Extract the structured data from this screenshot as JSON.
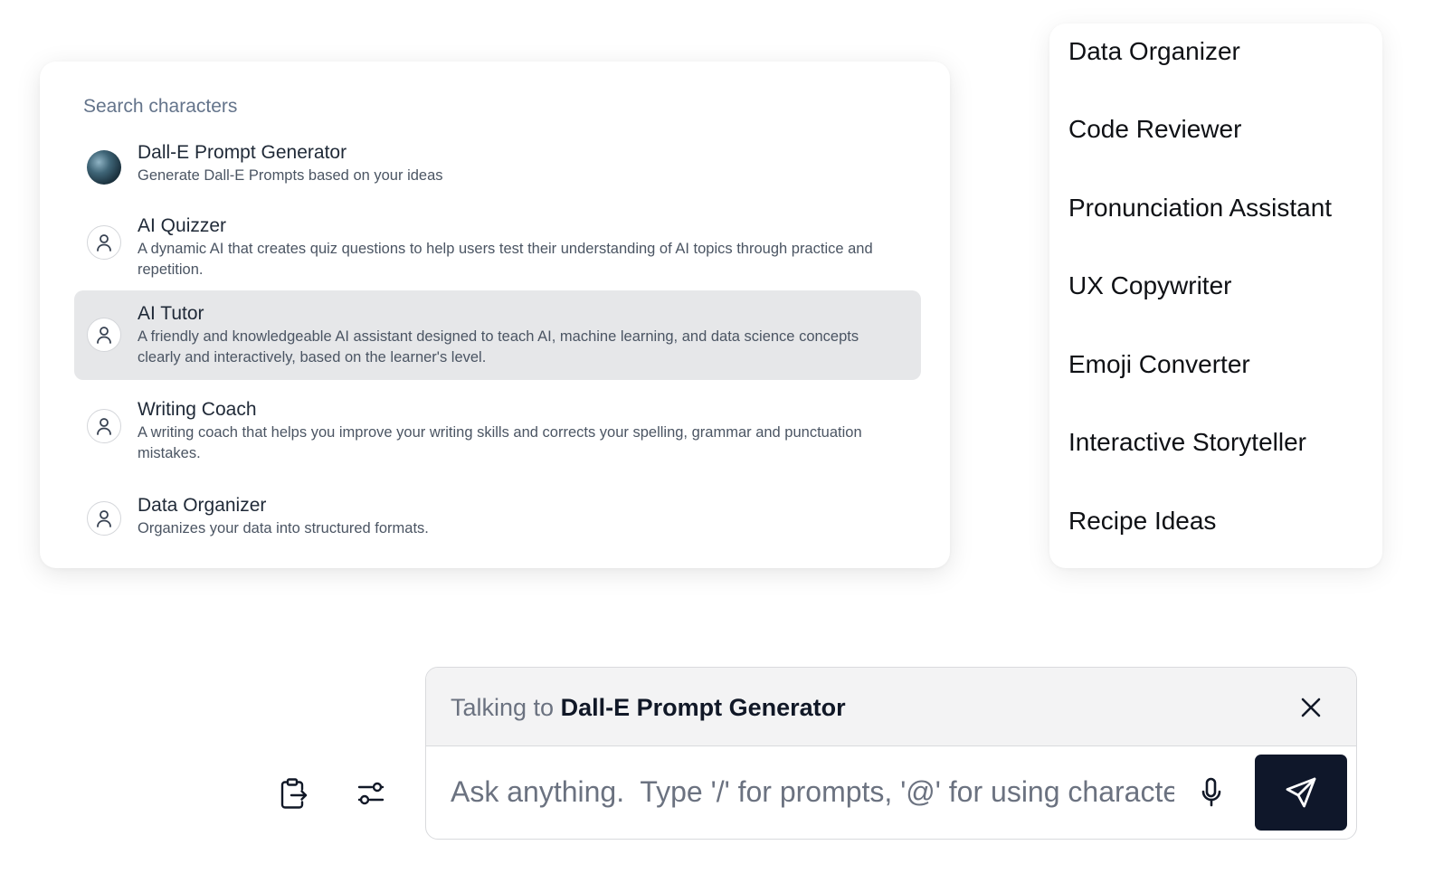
{
  "search": {
    "placeholder": "Search characters"
  },
  "characters": [
    {
      "name": "Dall-E Prompt Generator",
      "description": "Generate Dall-E Prompts based on your ideas",
      "avatar": "image-avatar"
    },
    {
      "name": "AI Quizzer",
      "description": "A dynamic AI that creates quiz questions to help users test their understanding of AI topics through practice and repetition.",
      "avatar": "user-icon"
    },
    {
      "name": "AI Tutor",
      "description": "A friendly and knowledgeable AI assistant designed to teach AI, machine learning, and data science concepts clearly and interactively, based on the learner's level.",
      "avatar": "user-icon",
      "selected": true
    },
    {
      "name": "Writing Coach",
      "description": "A writing coach that helps you improve your writing skills and corrects your spelling, grammar and punctuation mistakes.",
      "avatar": "user-icon"
    },
    {
      "name": "Data Organizer",
      "description": "Organizes your data into structured formats.",
      "avatar": "user-icon"
    }
  ],
  "menu": {
    "items": [
      "Data Organizer",
      "Code Reviewer",
      "Pronunciation Assistant",
      "UX Copywriter",
      "Emoji Converter",
      "Interactive Storyteller",
      "Recipe Ideas"
    ]
  },
  "chat": {
    "talking_prefix": "Talking to",
    "talking_name": "Dall-E Prompt Generator",
    "input_placeholder": "Ask anything.  Type '/' for prompts, '@' for using character",
    "input_value": ""
  },
  "toolbar": {
    "icons": [
      "clipboard-export-icon",
      "sliders-icon",
      "close-icon",
      "microphone-icon",
      "send-icon"
    ]
  },
  "colors": {
    "selected_row": "#e6e7e9",
    "send_button": "#0f172a",
    "chat_header": "#f3f3f4"
  }
}
